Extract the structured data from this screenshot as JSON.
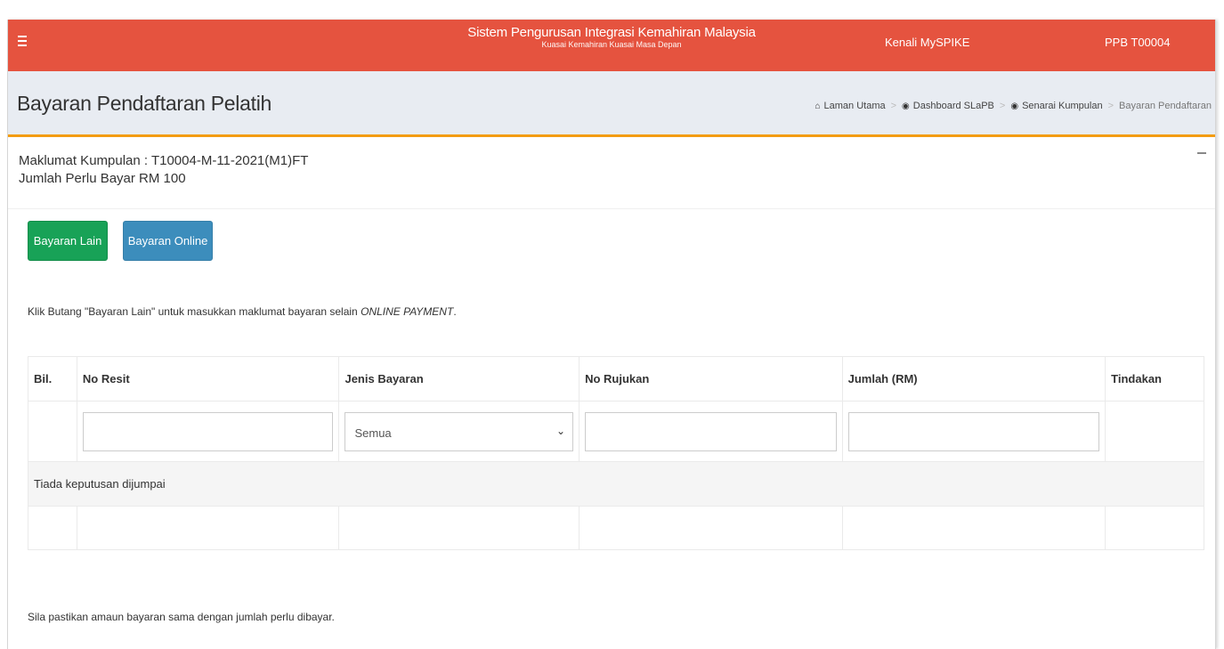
{
  "header": {
    "menu_icon": "hamburger-icon",
    "title": "Sistem Pengurusan Integrasi Kemahiran Malaysia",
    "subtitle": "Kuasai Kemahiran Kuasai Masa Depan",
    "kenali": "Kenali MySPIKE",
    "user": "PPB T00004",
    "accent": "#e5533f"
  },
  "page": {
    "title": "Bayaran Pendaftaran Pelatih",
    "breadcrumb": [
      {
        "label": "Laman Utama",
        "icon": "home-icon"
      },
      {
        "label": "Dashboard SLaPB",
        "icon": "dashboard-icon"
      },
      {
        "label": "Senarai Kumpulan",
        "icon": "group-icon"
      },
      {
        "label": "Bayaran Pendaftaran"
      }
    ]
  },
  "box": {
    "line1": "Maklumat Kumpulan : T10004-M-11-2021(M1)FT",
    "line2": "Jumlah Perlu Bayar RM 100"
  },
  "buttons": {
    "bayaran_lain": "Bayaran Lain",
    "bayaran_online": "Bayaran Online"
  },
  "info": {
    "text": "Klik Butang \"Bayaran Lain\" untuk masukkan maklumat bayaran selain ",
    "emphasis": "ONLINE PAYMENT",
    "end": "."
  },
  "table": {
    "columns": [
      "Bil.",
      "No Resit",
      "Jenis Bayaran",
      "No Rujukan",
      "Jumlah (RM)",
      "Tindakan"
    ],
    "filters": {
      "no_resit": "",
      "jenis_bayaran": "Semua",
      "no_rujukan": "",
      "jumlah": ""
    },
    "empty": "Tiada keputusan dijumpai"
  },
  "footnote": "Sila pastikan amaun bayaran sama dengan jumlah perlu dibayar."
}
